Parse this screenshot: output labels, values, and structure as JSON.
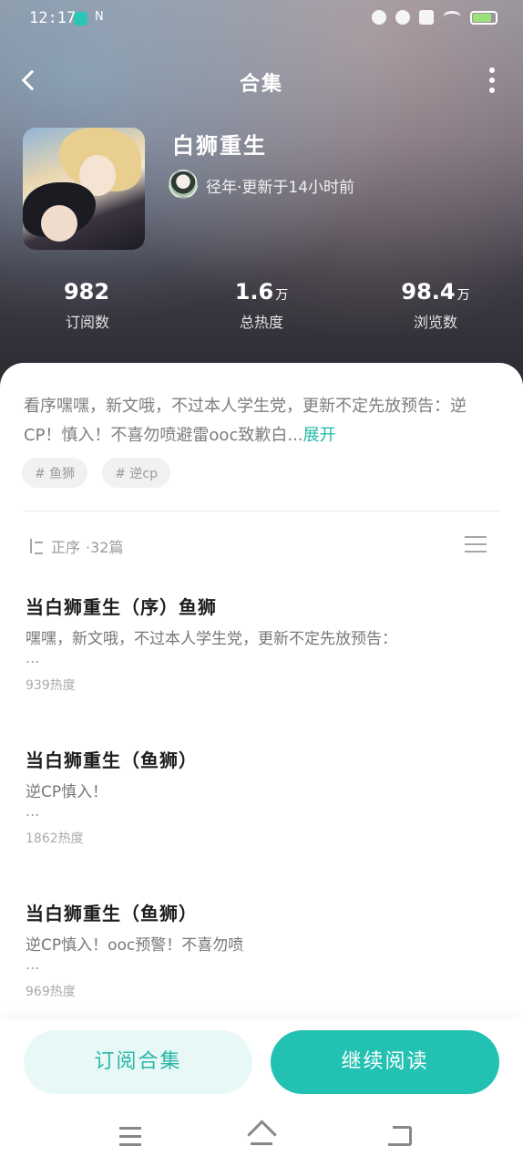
{
  "status": {
    "time": "12:17",
    "nfc": "N"
  },
  "header": {
    "title": "合集"
  },
  "work": {
    "title": "白狮重生",
    "author_info": "径年·更新于14小时前"
  },
  "stats": [
    {
      "num": "982",
      "unit": "",
      "label": "订阅数"
    },
    {
      "num": "1.6",
      "unit": "万",
      "label": "总热度"
    },
    {
      "num": "98.4",
      "unit": "万",
      "label": "浏览数"
    }
  ],
  "description": {
    "text": "看序嘿嘿，新文哦，不过本人学生党，更新不定先放预告：逆CP！慎入！不喜勿喷避雷ooc致歉白...",
    "expand_label": "展开"
  },
  "tags": [
    "# 鱼狮",
    "# 逆cp"
  ],
  "sort": {
    "order_label": "正序",
    "count_label": "·32篇"
  },
  "chapters": [
    {
      "title": "当白狮重生（序）鱼狮",
      "desc": "嘿嘿，新文哦，不过本人学生党，更新不定先放预告：",
      "more": "...",
      "heat": "939热度"
    },
    {
      "title": "当白狮重生（鱼狮）",
      "desc": "逆CP慎入！",
      "more": "...",
      "heat": "1862热度"
    },
    {
      "title": "当白狮重生（鱼狮）",
      "desc": "逆CP慎入！ooc预警！不喜勿喷",
      "more": "...",
      "heat": "969热度"
    }
  ],
  "actions": {
    "subscribe_label": "订阅合集",
    "continue_label": "继续阅读"
  },
  "colors": {
    "accent": "#22c1b2",
    "accent_light": "#e7f8f7"
  },
  "icons": {
    "back": "chevron-left-icon",
    "more": "more-vertical-icon",
    "sort": "sort-icon",
    "list": "list-icon"
  }
}
